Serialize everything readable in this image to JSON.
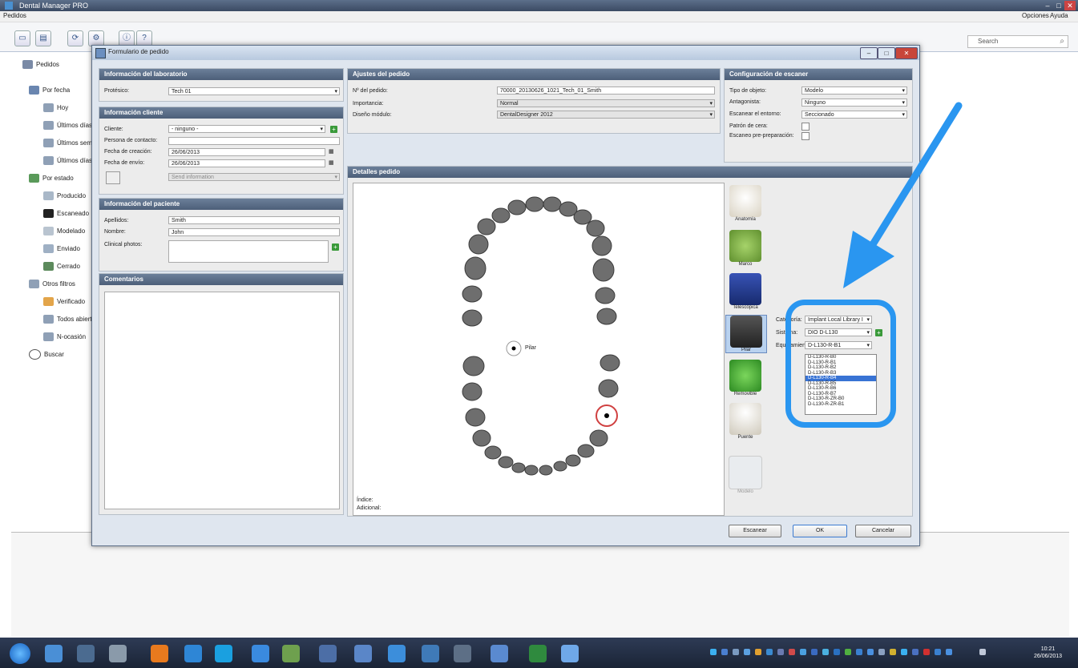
{
  "app": {
    "title": "Dental Manager PRO",
    "menu": {
      "left": "Pedidos",
      "opciones": "Opciones",
      "ayuda": "Ayuda"
    },
    "search_placeholder": "Search"
  },
  "tree": {
    "items": [
      {
        "label": "Pedidos",
        "level": 0
      },
      {
        "label": "Por fecha",
        "level": 1
      },
      {
        "label": "Hoy",
        "level": 2
      },
      {
        "label": "Últimos días",
        "level": 2
      },
      {
        "label": "Últimos sem",
        "level": 2
      },
      {
        "label": "Últimos días",
        "level": 2
      },
      {
        "label": "Por estado",
        "level": 1
      },
      {
        "label": "Producido",
        "level": 2
      },
      {
        "label": "Escaneado",
        "level": 2
      },
      {
        "label": "Modelado",
        "level": 2
      },
      {
        "label": "Enviado",
        "level": 2
      },
      {
        "label": "Cerrado",
        "level": 2
      },
      {
        "label": "Otros filtros",
        "level": 1
      },
      {
        "label": "Verificado",
        "level": 2
      },
      {
        "label": "Todos abiertos",
        "level": 2
      },
      {
        "label": "N-ocasión",
        "level": 2
      },
      {
        "label": "Buscar",
        "level": 1
      }
    ]
  },
  "dialog": {
    "title": "Formulario de pedido",
    "lab": {
      "header": "Información del laboratorio",
      "protesico_label": "Protésico:",
      "protesico_value": "Tech 01"
    },
    "client": {
      "header": "Información cliente",
      "cliente_label": "Cliente:",
      "cliente_value": "- ninguno -",
      "contacto_label": "Persona de contacto:",
      "creacion_label": "Fecha de creación:",
      "creacion_value": "26/06/2013",
      "envio_label": "Fecha de envío:",
      "envio_value": "26/06/2013",
      "send_info": "Send information"
    },
    "patient": {
      "header": "Información del paciente",
      "apellidos_label": "Apellidos:",
      "apellidos_value": "Smith",
      "nombre_label": "Nombre:",
      "nombre_value": "John",
      "photos_label": "Clinical photos:"
    },
    "comments": {
      "header": "Comentarios"
    },
    "order": {
      "header": "Ajustes del pedido",
      "numero_label": "Nº del pedido:",
      "numero_value": "70000_20130626_1021_Tech_01_Smith",
      "importancia_label": "Importancia:",
      "importancia_value": "Normal",
      "diseno_label": "Diseño módulo:",
      "diseno_value": "DentalDesigner 2012"
    },
    "scanner": {
      "header": "Configuración de escaner",
      "tipo_label": "Tipo de objeto:",
      "tipo_value": "Modelo",
      "antag_label": "Antagonista:",
      "antag_value": "Ninguno",
      "entorno_label": "Escanear el entorno:",
      "entorno_value": "Seccionado",
      "cera_label": "Patrón de cera:",
      "pre_label": "Escaneo pre-preparación:"
    },
    "details": {
      "header": "Detalles pedido",
      "pilar_label": "Pilar",
      "indice_label": "Índice:",
      "adicional_label": "Adicional:"
    },
    "tools": [
      "Anatomía",
      "Marco",
      "Telescópica",
      "Pilar",
      "Removible",
      "Puente",
      "Modelo"
    ],
    "abutment": {
      "categoria_label": "Categoría:",
      "categoria_value": "Implant Local Library I",
      "sistema_label": "Sistema:",
      "sistema_value": "DIO D-L130",
      "equipamiento_label": "Equipamiento:",
      "equipamiento_value": "D-L130-R-B1",
      "options": [
        "D-L130-R-B0",
        "D-L130-R-B1",
        "D-L130-R-B2",
        "D-L130-R-B3",
        "D-L130-R-B4",
        "D-L130-R-B5",
        "D-L130-R-B6",
        "D-L130-R-B7",
        "D-L130-R-ZR-B0",
        "D-L130-R-ZR-B1"
      ],
      "highlighted_index": 4
    },
    "buttons": {
      "escanear": "Escanear",
      "ok": "OK",
      "cancelar": "Cancelar"
    }
  },
  "taskbar": {
    "time": "10:21",
    "date": "26/06/2013"
  },
  "colors": {
    "annotation_blue": "#2a96f0",
    "panel_header": "#5a6d87",
    "selection": "#3873d4"
  }
}
